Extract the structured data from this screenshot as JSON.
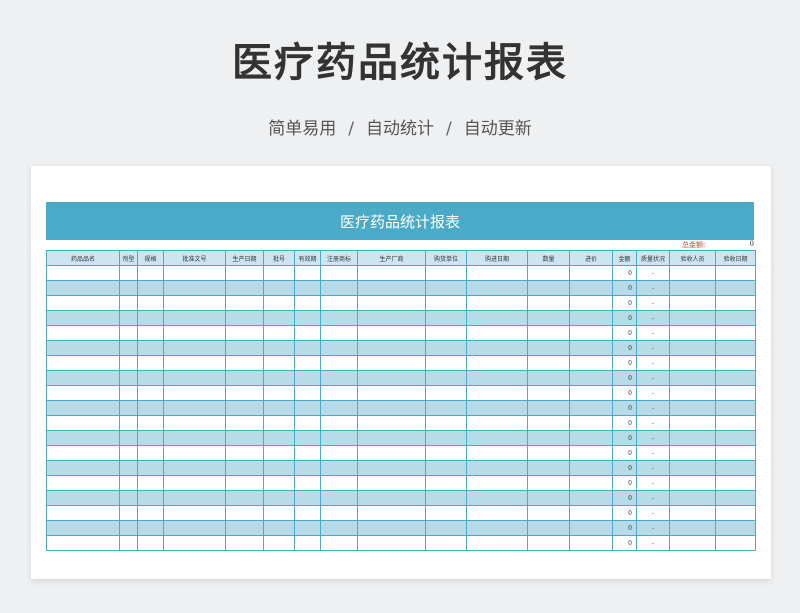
{
  "page": {
    "title": "医疗药品统计报表",
    "subtitle_parts": [
      "简单易用",
      "自动统计",
      "自动更新"
    ],
    "separator": "/"
  },
  "sheet": {
    "banner_title": "医疗药品统计报表",
    "total_label": "总金额:",
    "total_value": "0",
    "columns": [
      "药品品名",
      "剂型",
      "规格",
      "批准文号",
      "生产日期",
      "批号",
      "有效期",
      "注册商标",
      "生产厂商",
      "购货单位",
      "购进日期",
      "数量",
      "进价",
      "金额",
      "质量状况",
      "验收人员",
      "验收日期"
    ],
    "rows": [
      {
        "amount": "0",
        "quality": "-"
      },
      {
        "amount": "0",
        "quality": "-"
      },
      {
        "amount": "0",
        "quality": "-"
      },
      {
        "amount": "0",
        "quality": "-"
      },
      {
        "amount": "0",
        "quality": "-"
      },
      {
        "amount": "0",
        "quality": "-"
      },
      {
        "amount": "0",
        "quality": "-"
      },
      {
        "amount": "0",
        "quality": "-"
      },
      {
        "amount": "0",
        "quality": "-"
      },
      {
        "amount": "0",
        "quality": "-"
      },
      {
        "amount": "0",
        "quality": "-"
      },
      {
        "amount": "0",
        "quality": "-"
      },
      {
        "amount": "0",
        "quality": "-"
      },
      {
        "amount": "0",
        "quality": "-"
      },
      {
        "amount": "0",
        "quality": "-"
      },
      {
        "amount": "0",
        "quality": "-"
      },
      {
        "amount": "0",
        "quality": "-"
      },
      {
        "amount": "0",
        "quality": "-"
      },
      {
        "amount": "0",
        "quality": "-"
      }
    ],
    "colors": {
      "accent": "#4aaac8",
      "stripe": "#b7dce8",
      "total_label": "#e53935"
    }
  }
}
